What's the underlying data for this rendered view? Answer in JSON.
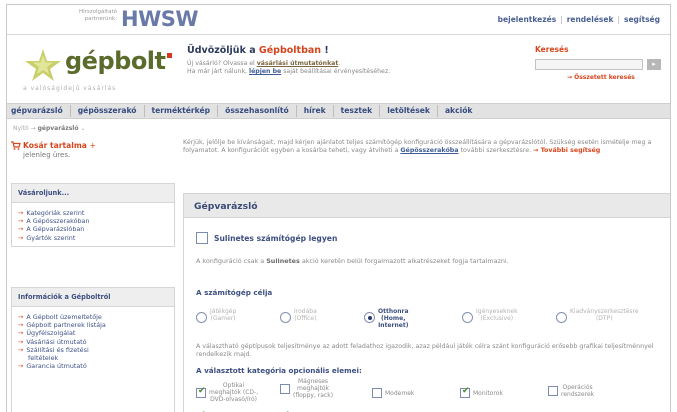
{
  "header": {
    "partner_text": "Hírszolgáltató partnerünk:",
    "partner_logo": "HWSW",
    "links": [
      "bejelentkezés",
      "rendelések",
      "segítség"
    ]
  },
  "logo": {
    "brand": "gépbolt",
    "slogan": "a valóságidejű vásárlás"
  },
  "welcome": {
    "title_prefix": "Üdvözöljük a ",
    "title_accent": "Gépboltban",
    "title_suffix": " !",
    "line1_a": "Új vásárló? Olvassa el ",
    "line1_link": "vásárlási útmutatónkat",
    "line1_b": ".",
    "line2_a": "Ha már járt nálunk, ",
    "line2_link": "lépjen be",
    "line2_b": " saját beállításai érvényesítéséhez."
  },
  "search": {
    "label": "Keresés",
    "value": "",
    "advanced": "Összetett keresés"
  },
  "nav": [
    "gépvarázsló",
    "gépösszerakó",
    "terméktérkép",
    "összehasonlító",
    "hírek",
    "tesztek",
    "letöltések",
    "akciók"
  ],
  "breadcrumb": {
    "home": "Nyitó",
    "current": "gépvarázsló"
  },
  "cart": {
    "title": "Kosár tartalma",
    "status": "jelenleg üres."
  },
  "box_shop": {
    "title": "Vásároljunk...",
    "items": [
      "Kategóriák szerint",
      "A Gépösszerakóban",
      "A Gépvarázslóban",
      "Gyártók szerint"
    ]
  },
  "box_info": {
    "title": "Információk a Gépboltról",
    "items": [
      "A Gépbolt üzemeltetője",
      "Gépbolt partnerek listája",
      "Ügyfélszolgálat",
      "Vásárlási útmutató",
      "Szállítási és fizetési",
      "feltételek",
      "Garancia útmutató"
    ]
  },
  "intro": {
    "text_a": "Kérjük, jelölje be kívánságait, majd kérjen ajánlatot teljes számítógép konfiguráció összeállítására a gépvarázslótól. Szükség esetén ismételje meg a folyamatot. A konfigurációt egyben a kosárba teheti, vagy átviheti a ",
    "link": "Gépösszerakóba",
    "text_b": " további szerkesztésre.",
    "help": "További segítség"
  },
  "config": {
    "title": "Gépvarázsló",
    "sulinet_label": "Sulinetes számítógép legyen",
    "sulinet_checked": false,
    "note_a": "A konfiguráció csak a ",
    "note_bold": "Sulinetes",
    "note_b": " akció keretén belül forgalmazott alkatrészeket fogja tartalmazni.",
    "purpose_heading": "A számítógép célja",
    "purposes": [
      {
        "l1": "Játékgép",
        "l2": "(Gamer)",
        "l3": "",
        "selected": false
      },
      {
        "l1": "Irodába",
        "l2": "(Office)",
        "l3": "",
        "selected": false
      },
      {
        "l1": "Otthonra",
        "l2": "(Home,",
        "l3": "Internet)",
        "selected": true
      },
      {
        "l1": "Igényeseknek",
        "l2": "(Exclusive)",
        "l3": "",
        "selected": false
      },
      {
        "l1": "Kiadványszerkesztésre",
        "l2": "(DTP)",
        "l3": "",
        "selected": false
      }
    ],
    "purpose_note": "A választható géptípusok teljesítménye az adott feladathoz igazodik, azaz például játék célra szánt konfiguráció erősebb grafikai teljesítménnyel rendelkezik majd.",
    "options_heading": "A választott kategória opcionális elemei:",
    "options": [
      {
        "l1": "Optikai",
        "l2": "meghajtók (CD-,",
        "l3": "DVD-olvasó/író)",
        "checked": true
      },
      {
        "l1": "Mágneses",
        "l2": "meghajtók",
        "l3": "(floppy, rack)",
        "checked": false
      },
      {
        "l1": "Modemek",
        "l2": "",
        "l3": "",
        "checked": false
      },
      {
        "l1": "Monitorok",
        "l2": "",
        "l3": "",
        "checked": true
      },
      {
        "l1": "Operációs",
        "l2": "rendszerek",
        "l3": "",
        "checked": false
      }
    ]
  }
}
